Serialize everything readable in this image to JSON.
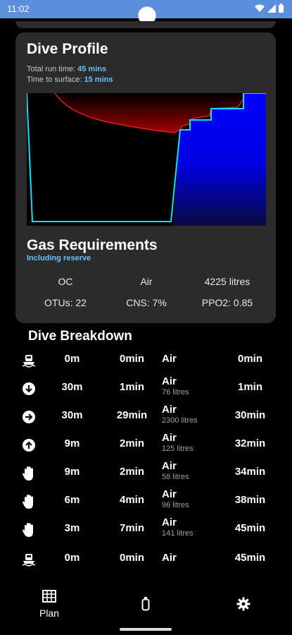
{
  "status_bar": {
    "time": "11:02"
  },
  "profile": {
    "title": "Dive Profile",
    "run_time_label": "Total run time: ",
    "run_time_value": "45 mins",
    "surface_label": "Time to surface: ",
    "surface_value": "15 mins"
  },
  "gas": {
    "title": "Gas Requirements",
    "subtitle": "Including reserve",
    "mode": "OC",
    "gas": "Air",
    "volume": "4225 litres",
    "otus": "OTUs: 22",
    "cns": "CNS: 7%",
    "ppo2": "PPO2: 0.85"
  },
  "breakdown": {
    "title": "Dive Breakdown",
    "rows": [
      {
        "icon": "boat-icon",
        "depth": "0m",
        "duration": "0min",
        "gas": "Air",
        "litres": "",
        "runtime": "0min"
      },
      {
        "icon": "descend-icon",
        "depth": "30m",
        "duration": "1min",
        "gas": "Air",
        "litres": "76 litres",
        "runtime": "1min"
      },
      {
        "icon": "level-icon",
        "depth": "30m",
        "duration": "29min",
        "gas": "Air",
        "litres": "2300 litres",
        "runtime": "30min"
      },
      {
        "icon": "ascend-icon",
        "depth": "9m",
        "duration": "2min",
        "gas": "Air",
        "litres": "125 litres",
        "runtime": "32min"
      },
      {
        "icon": "stop-hand-icon",
        "depth": "9m",
        "duration": "2min",
        "gas": "Air",
        "litres": "58 litres",
        "runtime": "34min"
      },
      {
        "icon": "stop-hand-icon",
        "depth": "6m",
        "duration": "4min",
        "gas": "Air",
        "litres": "96 litres",
        "runtime": "38min"
      },
      {
        "icon": "stop-hand-icon",
        "depth": "3m",
        "duration": "7min",
        "gas": "Air",
        "litres": "141 litres",
        "runtime": "45min"
      },
      {
        "icon": "boat-icon",
        "depth": "0m",
        "duration": "0min",
        "gas": "Air",
        "litres": "",
        "runtime": "45min"
      }
    ]
  },
  "nav": {
    "plan_label": "Plan",
    "plan_icon": "grid-icon",
    "gas_icon": "cylinder-icon",
    "settings_icon": "gear-icon"
  },
  "colors": {
    "accent": "#66c2ff",
    "profile_line": "#00e5ff",
    "ceiling_fill": "#8b0000",
    "ascent_fill": "#0000ff",
    "card": "#2b2b2b"
  }
}
